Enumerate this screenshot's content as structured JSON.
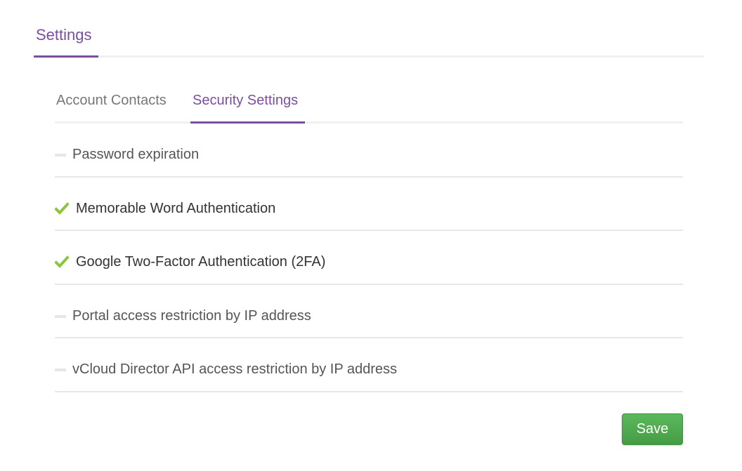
{
  "header": {
    "tab_label": "Settings"
  },
  "sub_tabs": [
    {
      "label": "Account Contacts",
      "active": false
    },
    {
      "label": "Security Settings",
      "active": true
    }
  ],
  "settings": [
    {
      "label": "Password expiration",
      "enabled": false,
      "icon": "dash-icon"
    },
    {
      "label": "Memorable Word Authentication",
      "enabled": true,
      "icon": "check-icon"
    },
    {
      "label": "Google Two-Factor Authentication (2FA)",
      "enabled": true,
      "icon": "check-icon"
    },
    {
      "label": "Portal access restriction by IP address",
      "enabled": false,
      "icon": "dash-icon"
    },
    {
      "label": "vCloud Director API access restriction by IP address",
      "enabled": false,
      "icon": "dash-icon"
    }
  ],
  "actions": {
    "save_label": "Save"
  },
  "colors": {
    "accent": "#7b4f9e",
    "check": "#8cc63f",
    "save": "#5cb85c"
  }
}
